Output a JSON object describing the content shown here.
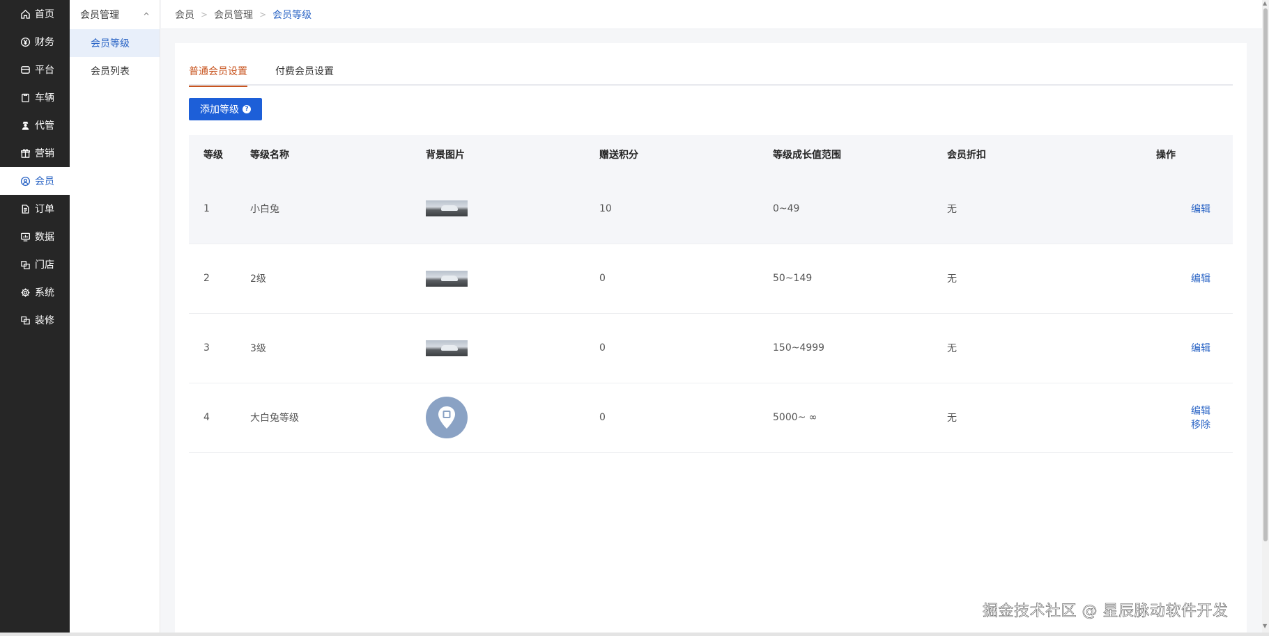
{
  "sidebar": {
    "items": [
      {
        "label": "首页",
        "icon": "home-icon"
      },
      {
        "label": "财务",
        "icon": "yen-icon"
      },
      {
        "label": "平台",
        "icon": "store-icon"
      },
      {
        "label": "车辆",
        "icon": "clipboard-icon"
      },
      {
        "label": "代管",
        "icon": "agent-icon"
      },
      {
        "label": "营销",
        "icon": "gift-icon"
      },
      {
        "label": "会员",
        "icon": "user-circle-icon",
        "active": true
      },
      {
        "label": "订单",
        "icon": "document-icon"
      },
      {
        "label": "数据",
        "icon": "monitor-chart-icon"
      },
      {
        "label": "门店",
        "icon": "shop-icon"
      },
      {
        "label": "系统",
        "icon": "gear-icon"
      },
      {
        "label": "装修",
        "icon": "decorate-icon"
      }
    ]
  },
  "submenu": {
    "title": "会员管理",
    "items": [
      {
        "label": "会员等级",
        "active": true
      },
      {
        "label": "会员列表"
      }
    ]
  },
  "breadcrumb": [
    "会员",
    "会员管理",
    "会员等级"
  ],
  "tabs": [
    {
      "label": "普通会员设置",
      "active": true
    },
    {
      "label": "付费会员设置"
    }
  ],
  "add_button": {
    "label": "添加等级",
    "help_icon": "question-circle-icon"
  },
  "table": {
    "headers": [
      "等级",
      "等级名称",
      "背景图片",
      "赠送积分",
      "等级成长值范围",
      "会员折扣",
      "操作"
    ],
    "rows": [
      {
        "level": "1",
        "name": "小白兔",
        "image": "car-thumbnail",
        "points": "10",
        "range": "0~49",
        "discount": "无",
        "actions": [
          "编辑"
        ]
      },
      {
        "level": "2",
        "name": "2级",
        "image": "car-thumbnail",
        "points": "0",
        "range": "50~149",
        "discount": "无",
        "actions": [
          "编辑"
        ]
      },
      {
        "level": "3",
        "name": "3级",
        "image": "car-thumbnail",
        "points": "0",
        "range": "150~4999",
        "discount": "无",
        "actions": [
          "编辑"
        ]
      },
      {
        "level": "4",
        "name": "大白兔等级",
        "image": "pin-thumbnail",
        "points": "0",
        "range": "5000~ ∞",
        "discount": "无",
        "actions": [
          "编辑",
          "移除"
        ]
      }
    ]
  },
  "watermark": "掘金技术社区 @ 星辰脉动软件开发",
  "colors": {
    "accent": "#2a64c5",
    "tab_active": "#c8541f",
    "sidebar_bg": "#262626",
    "button_bg": "#1d5fd8"
  }
}
